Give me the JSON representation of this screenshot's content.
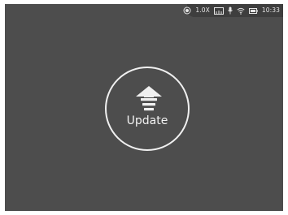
{
  "status_bar": {
    "zoom": "1.0X",
    "time": "10:33",
    "icons": [
      "target-icon",
      "ruler-icon",
      "microphone-icon",
      "wifi-icon",
      "battery-icon"
    ]
  },
  "main": {
    "update_label": "Update",
    "update_icon": "upload-arrow-icon"
  },
  "colors": {
    "screen_background": "#4d4d4d",
    "status_bar_background": "#3e3e3e",
    "foreground": "#f0f0f0"
  }
}
